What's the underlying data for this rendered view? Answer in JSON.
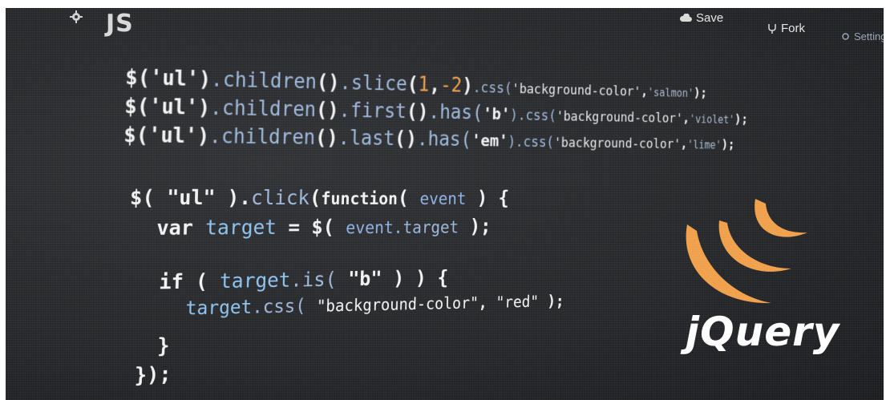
{
  "toolbar": {
    "title": "JS",
    "save_label": "Save",
    "fork_label": "Fork",
    "settings_label": "Setting",
    "icons": [
      "gear-icon",
      "cloud-icon",
      "fork-icon",
      "settings-gear-icon"
    ]
  },
  "code": {
    "line1": {
      "a": "$('ul')",
      "b": ".children",
      "c": "()",
      "d": ".slice",
      "e": "(",
      "f": "1",
      "g": ",",
      "h": "-2",
      "i": ")",
      "j": ".css(",
      "k": "'background-color'",
      "l": ",",
      "m": "'salmon'",
      "n": ");"
    },
    "line2": {
      "a": "$('ul')",
      "b": ".children",
      "c": "()",
      "d": ".first",
      "e": "()",
      "f": ".has(",
      "g": "'b'",
      "h": ").css(",
      "i": "'background-color'",
      "j": ",",
      "k": "'violet'",
      "l": ");"
    },
    "line3": {
      "a": "$('ul')",
      "b": ".children",
      "c": "()",
      "d": ".last",
      "e": "()",
      "f": ".has(",
      "g": "'em'",
      "h": ").css(",
      "i": "'background-color'",
      "j": ",",
      "k": "'lime'",
      "l": ");"
    },
    "line4": {
      "a": "$( ",
      "b": "\"ul\"",
      "c": " ).",
      "d": "click",
      "e": "(",
      "f": "function",
      "g": "( ",
      "h": "event",
      "i": " ) {"
    },
    "line5": {
      "a": "var ",
      "b": "target",
      "c": " = $( ",
      "d": "event",
      "e": ".target",
      "f": " );"
    },
    "line6": {
      "a": "if ( ",
      "b": "target",
      "c": ".is( ",
      "d": "\"b\"",
      "e": " ) ) {"
    },
    "line7": {
      "a": "target",
      "b": ".css( ",
      "c": "\"background-color\"",
      "d": ", ",
      "e": "\"red\"",
      "f": " );"
    },
    "line8": "}",
    "line9": "});"
  },
  "logo": {
    "text": "jQuery",
    "color": "#f0a04a"
  }
}
